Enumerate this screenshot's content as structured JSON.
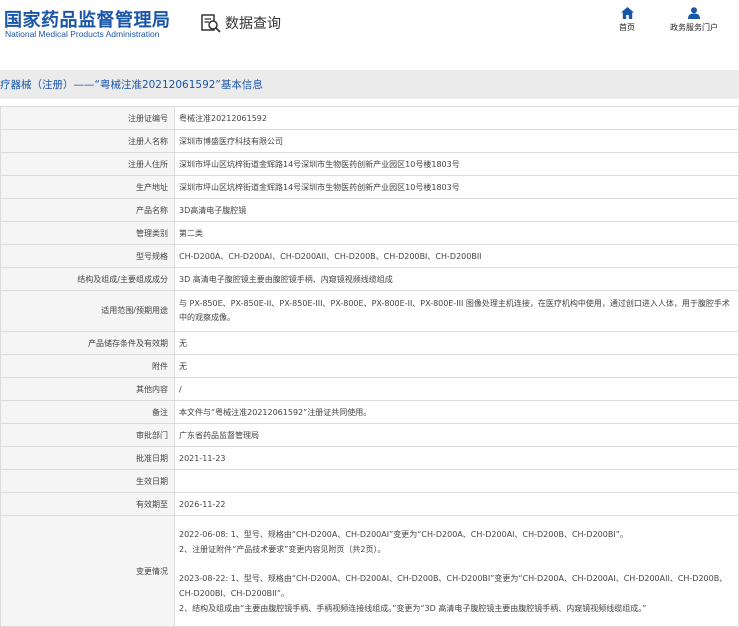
{
  "header": {
    "logo_cn": "国家药品监督管理局",
    "logo_en": "National Medical Products Administration",
    "search_label": "数据查询",
    "nav": [
      {
        "label": "首页",
        "icon": "home-icon"
      },
      {
        "label": "政务服务门户",
        "icon": "user-icon"
      }
    ]
  },
  "title": "疗器械（注册）——“粤械注准20212061592”基本信息",
  "rows": [
    {
      "label": "注册证编号",
      "value": "粤械注准20212061592"
    },
    {
      "label": "注册人名称",
      "value": "深圳市博盛医疗科技有限公司"
    },
    {
      "label": "注册人住所",
      "value": "深圳市坪山区坑梓街道金辉路14号深圳市生物医药创新产业园区10号楼1803号"
    },
    {
      "label": "生产地址",
      "value": "深圳市坪山区坑梓街道金辉路14号深圳市生物医药创新产业园区10号楼1803号"
    },
    {
      "label": "产品名称",
      "value": "3D高清电子腹腔镜"
    },
    {
      "label": "管理类别",
      "value": "第二类"
    },
    {
      "label": "型号规格",
      "value": "CH-D200A、CH-D200AI、CH-D200AII、CH-D200B、CH-D200BI、CH-D200BII"
    },
    {
      "label": "结构及组成/主要组成成分",
      "value": "3D 高清电子腹腔镜主要由腹腔镜手柄、内窥镜视频线缆组成"
    },
    {
      "label": "适用范围/预期用途",
      "value": "与 PX-850E、PX-850E-II、PX-850E-III、PX-800E、PX-800E-II、PX-800E-III 图像处理主机连接，在医疗机构中使用，通过创口进入人体，用于腹腔手术中的观察成像。"
    },
    {
      "label": "产品储存条件及有效期",
      "value": "无"
    },
    {
      "label": "附件",
      "value": "无"
    },
    {
      "label": "其他内容",
      "value": "/"
    },
    {
      "label": "备注",
      "value": "本文件与“粤械注准20212061592”注册证共同使用。"
    },
    {
      "label": "审批部门",
      "value": "广东省药品监督管理局"
    },
    {
      "label": "批准日期",
      "value": "2021-11-23"
    },
    {
      "label": "生效日期",
      "value": ""
    },
    {
      "label": "有效期至",
      "value": "2026-11-22"
    }
  ],
  "changes": {
    "label": "变更情况",
    "lines": [
      "2022-06-08: 1、型号、规格由“CH-D200A、CH-D200AI”变更为“CH-D200A、CH-D200AI、CH-D200B、CH-D200BI”。",
      "2、注册证附件“产品技术要求”变更内容见附页（共2页）。",
      "",
      "2023-08-22: 1、型号、规格由“CH-D200A、CH-D200AI、CH-D200B、CH-D200BI”变更为“CH-D200A、CH-D200AI、CH-D200AII、CH-D200B、CH-D200BI、CH-D200BII”。",
      "2、结构及组成由“主要由腹腔镜手柄、手柄视频连接线组成。”变更为“3D 高清电子腹腔镜主要由腹腔镜手柄、内窥镜视频线缆组成。”"
    ]
  },
  "colors": {
    "brand": "#1a56a7",
    "label_bg": "#f5f5f5",
    "title_bg": "#ebebeb",
    "border": "#dcdcdc"
  }
}
